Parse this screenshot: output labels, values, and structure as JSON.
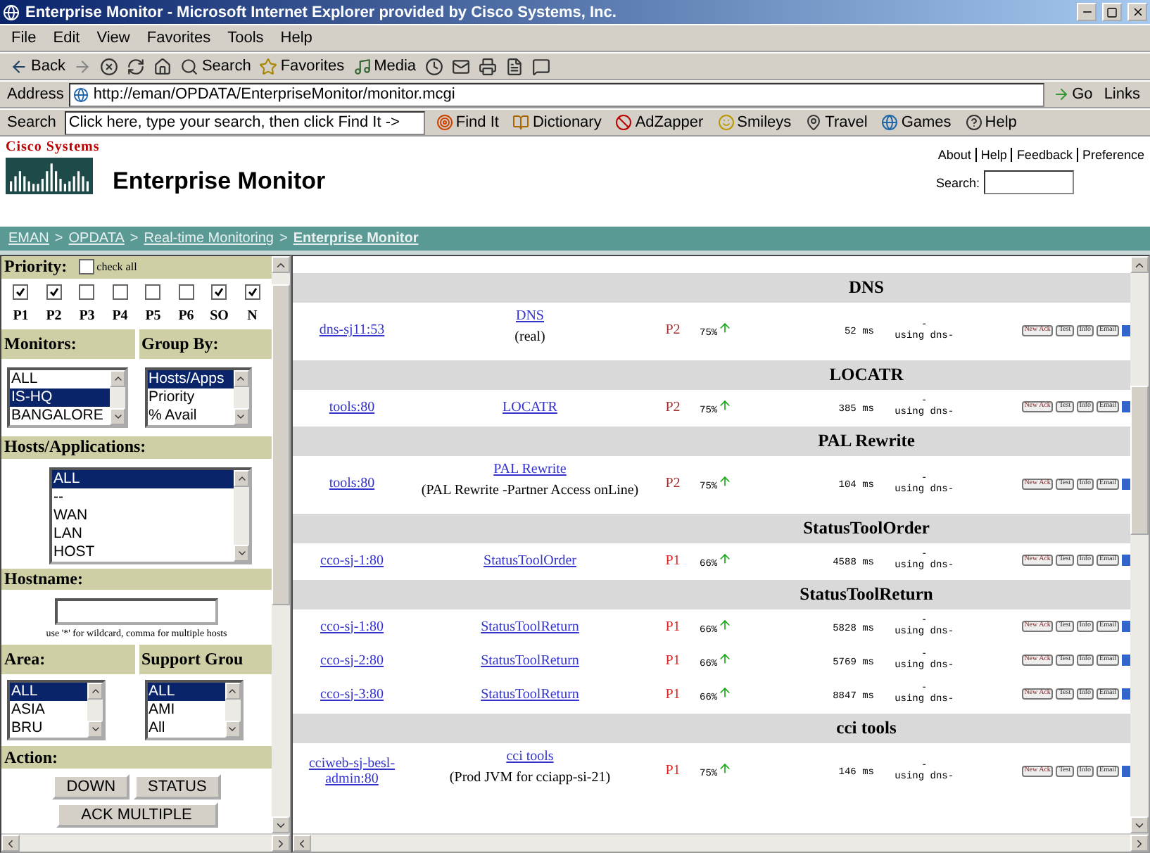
{
  "window": {
    "title": "Enterprise Monitor - Microsoft Internet Explorer provided by Cisco Systems, Inc."
  },
  "menu": [
    "File",
    "Edit",
    "View",
    "Favorites",
    "Tools",
    "Help"
  ],
  "toolbar": [
    {
      "kind": "back",
      "label": "Back"
    },
    {
      "kind": "forward"
    },
    {
      "kind": "stop"
    },
    {
      "kind": "refresh"
    },
    {
      "kind": "home"
    },
    {
      "kind": "search",
      "label": "Search"
    },
    {
      "kind": "favorites",
      "label": "Favorites"
    },
    {
      "kind": "media",
      "label": "Media"
    },
    {
      "kind": "history"
    },
    {
      "kind": "mail"
    },
    {
      "kind": "print"
    },
    {
      "kind": "edit"
    },
    {
      "kind": "discuss"
    }
  ],
  "address": {
    "label": "Address",
    "value": "http://eman/OPDATA/EnterpriseMonitor/monitor.mcgi",
    "go": "Go",
    "links": "Links"
  },
  "search_bar": {
    "label": "Search",
    "value": "Click here, type your search, then click Find It ->",
    "buttons": [
      "Find It",
      "Dictionary",
      "AdZapper",
      "Smileys",
      "Travel",
      "Games",
      "Help"
    ]
  },
  "header": {
    "logo": "Cisco Systems",
    "title": "Enterprise Monitor",
    "links": [
      "About",
      "Help",
      "Feedback",
      "Preference"
    ],
    "search_label": "Search:"
  },
  "breadcrumb_separator": ">",
  "breadcrumb": [
    {
      "label": "EMAN",
      "current": false
    },
    {
      "label": "OPDATA",
      "current": false
    },
    {
      "label": "Real-time Monitoring",
      "current": false
    },
    {
      "label": "Enterprise Monitor",
      "current": true
    }
  ],
  "sidebar": {
    "priority": {
      "title": "Priority:",
      "check_all": {
        "label": "check all",
        "checked": false
      },
      "levels": [
        {
          "label": "P1",
          "checked": true
        },
        {
          "label": "P2",
          "checked": true
        },
        {
          "label": "P3",
          "checked": false
        },
        {
          "label": "P4",
          "checked": false
        },
        {
          "label": "P5",
          "checked": false
        },
        {
          "label": "P6",
          "checked": false
        },
        {
          "label": "SO",
          "checked": true
        },
        {
          "label": "N",
          "checked": true
        }
      ]
    },
    "monitors": {
      "title": "Monitors:",
      "items": [
        {
          "label": "ALL",
          "selected": false
        },
        {
          "label": "IS-HQ",
          "selected": true
        },
        {
          "label": "BANGALORE",
          "selected": false
        }
      ]
    },
    "group_by": {
      "title": "Group By:",
      "items": [
        {
          "label": "Hosts/Apps",
          "selected": true
        },
        {
          "label": "Priority",
          "selected": false
        },
        {
          "label": "% Avail",
          "selected": false
        }
      ]
    },
    "hosts": {
      "title": "Hosts/Applications:",
      "items": [
        {
          "label": "ALL",
          "selected": true
        },
        {
          "label": "--",
          "selected": false
        },
        {
          "label": "WAN",
          "selected": false
        },
        {
          "label": "LAN",
          "selected": false
        },
        {
          "label": "HOST",
          "selected": false
        }
      ]
    },
    "hostname": {
      "title": "Hostname:",
      "hint": "use '*' for wildcard, comma for multiple hosts"
    },
    "area": {
      "title": "Area:",
      "items": [
        {
          "label": "ALL",
          "selected": true
        },
        {
          "label": "ASIA",
          "selected": false
        },
        {
          "label": "BRU",
          "selected": false
        }
      ]
    },
    "support_group": {
      "title": "Support Grou",
      "items": [
        {
          "label": "ALL",
          "selected": true
        },
        {
          "label": "AMI",
          "selected": false
        },
        {
          "label": "All",
          "selected": false
        }
      ]
    },
    "action": {
      "title": "Action:",
      "buttons": [
        "DOWN",
        "STATUS",
        "ACK MULTIPLE"
      ]
    }
  },
  "table": {
    "rows": [
      {
        "kind": "group",
        "title": "DNS"
      },
      {
        "kind": "item",
        "host": "dns-sj11:53",
        "service": "DNS",
        "note": "(real)",
        "priority": "P2",
        "color": "#a03030",
        "availability": "75%",
        "response": "52 ms",
        "dash": "-",
        "dns": "using dns-",
        "actions": [
          "New Ack",
          "Test",
          "Info",
          "Email"
        ]
      },
      {
        "kind": "group",
        "title": "LOCATR"
      },
      {
        "kind": "item",
        "host": "tools:80",
        "service": "LOCATR",
        "priority": "P2",
        "color": "#a03030",
        "availability": "75%",
        "response": "385 ms",
        "dash": "-",
        "dns": "using dns-",
        "actions": [
          "New Ack",
          "Test",
          "Info",
          "Email"
        ]
      },
      {
        "kind": "group",
        "title": "PAL Rewrite"
      },
      {
        "kind": "item",
        "host": "tools:80",
        "service": "PAL Rewrite",
        "note": "(PAL Rewrite -Partner Access onLine)",
        "priority": "P2",
        "color": "#a03030",
        "availability": "75%",
        "response": "104 ms",
        "dash": "-",
        "dns": "using dns-",
        "actions": [
          "New Ack",
          "Test",
          "Info",
          "Email"
        ]
      },
      {
        "kind": "group",
        "title": "StatusToolOrder"
      },
      {
        "kind": "item",
        "host": "cco-sj-1:80",
        "service": "StatusToolOrder",
        "priority": "P1",
        "color": "#e02020",
        "availability": "66%",
        "response": "4588 ms",
        "dash": "-",
        "dns": "using dns-",
        "actions": [
          "New Ack",
          "Test",
          "Info",
          "Email"
        ]
      },
      {
        "kind": "group",
        "title": "StatusToolReturn"
      },
      {
        "kind": "item",
        "host": "cco-sj-1:80",
        "service": "StatusToolReturn",
        "priority": "P1",
        "color": "#e02020",
        "availability": "66%",
        "response": "5828 ms",
        "dash": "-",
        "dns": "using dns-",
        "actions": [
          "New Ack",
          "Test",
          "Info",
          "Email"
        ]
      },
      {
        "kind": "item",
        "host": "cco-sj-2:80",
        "service": "StatusToolReturn",
        "priority": "P1",
        "color": "#e02020",
        "availability": "66%",
        "response": "5769 ms",
        "dash": "-",
        "dns": "using dns-",
        "actions": [
          "New Ack",
          "Test",
          "Info",
          "Email"
        ]
      },
      {
        "kind": "item",
        "host": "cco-sj-3:80",
        "service": "StatusToolReturn",
        "priority": "P1",
        "color": "#e02020",
        "availability": "66%",
        "response": "8847 ms",
        "dash": "-",
        "dns": "using dns-",
        "actions": [
          "New Ack",
          "Test",
          "Info",
          "Email"
        ]
      },
      {
        "kind": "group",
        "title": "cci tools"
      },
      {
        "kind": "item",
        "host": "cciweb-sj-besl-admin:80",
        "service": "cci tools",
        "note": "(Prod JVM for cciapp-si-21)",
        "priority": "P1",
        "color": "#e02020",
        "availability": "75%",
        "response": "146 ms",
        "dash": "-",
        "dns": "using dns-",
        "actions": [
          "New Ack",
          "Test",
          "Info",
          "Email"
        ]
      }
    ]
  }
}
